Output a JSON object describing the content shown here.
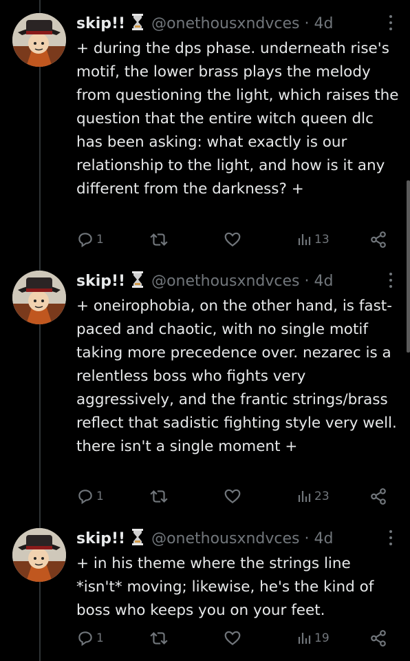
{
  "tweets": [
    {
      "name": "skip!!",
      "handle": "@onethousxndvces",
      "dot": "·",
      "time": "4d",
      "text": "+ during the dps phase. underneath rise's motif, the lower brass plays the melody from questioning the light, which raises the question that the entire witch queen dlc has been asking: what exactly is our relationship to the light, and how is it any different from the darkness? +",
      "replies": "1",
      "views": "13"
    },
    {
      "name": "skip!!",
      "handle": "@onethousxndvces",
      "dot": "·",
      "time": "4d",
      "text": "+ oneirophobia, on the other hand, is fast-paced and chaotic, with no single motif taking more precedence over. nezarec is a relentless boss who fights very aggressively, and the frantic strings/brass reflect that sadistic fighting style very well. there isn't a single moment +",
      "replies": "1",
      "views": "23"
    },
    {
      "name": "skip!!",
      "handle": "@onethousxndvces",
      "dot": "·",
      "time": "4d",
      "text": "+ in his theme where the strings line *isn't* moving; likewise, he's the kind of boss who keeps you on your feet.",
      "replies": "1",
      "views": "19"
    }
  ],
  "icons": {
    "reply": "reply-icon",
    "retweet": "retweet-icon",
    "like": "heart-icon",
    "views": "views-chart-icon",
    "share": "share-icon",
    "more": "more-options-icon",
    "badge": "hourglass-emoji"
  },
  "colors": {
    "background": "#000000",
    "text": "#e7e9ea",
    "secondary": "#71767b",
    "hourglass": "#e6e6e6"
  }
}
